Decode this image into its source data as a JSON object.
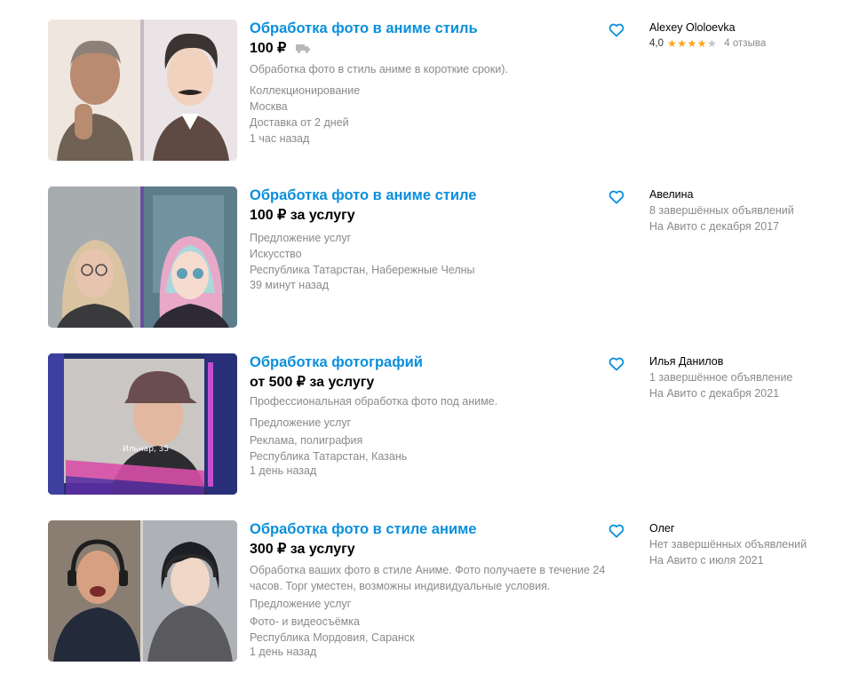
{
  "listings": [
    {
      "title": "Обработка фото в аниме стиль",
      "price": "100 ₽",
      "description": "Обработка фото в стиль аниме в короткие сроки).",
      "category": "Коллекционирование",
      "location": "Москва",
      "delivery": "Доставка от 2 дней",
      "posted": "1 час назад",
      "seller": {
        "name": "Alexey Ololoevka",
        "rating": "4,0",
        "stars": 4,
        "reviews": "4 отзыва"
      }
    },
    {
      "title": "Обработка фото в аниме стиле",
      "price": "100 ₽ за услугу",
      "type": "Предложение услуг",
      "category": "Искусство",
      "location": "Республика Татарстан, Набережные Челны",
      "posted": "39 минут назад",
      "seller": {
        "name": "Авелина",
        "completed": "8 завершённых объявлений",
        "since": "На Авито с декабря 2017"
      }
    },
    {
      "title": "Обработка фотографий",
      "price": "от 500 ₽ за услугу",
      "description": "Профессиональная обработка фото под аниме.",
      "type": "Предложение услуг",
      "category": "Реклама, полиграфия",
      "location": "Республика Татарстан, Казань",
      "posted": "1 день назад",
      "image_caption": "Ильнар, 35",
      "seller": {
        "name": "Илья Данилов",
        "completed": "1 завершённое объявление",
        "since": "На Авито с декабря 2021"
      }
    },
    {
      "title": "Обработка фото в стиле аниме",
      "price": "300 ₽ за услугу",
      "description": "Обработка ваших фото в стиле Аниме. Фото получаете в течение 24 часов. Торг уместен, возможны индивидуальные условия.",
      "type": "Предложение услуг",
      "category": "Фото- и видеосъёмка",
      "location": "Республика Мордовия, Саранск",
      "posted": "1 день назад",
      "seller": {
        "name": "Олег",
        "completed": "Нет завершённых объявлений",
        "since": "На Авито с июля 2021"
      }
    }
  ],
  "colors": {
    "title": "#0a8fdc",
    "secondary_text": "#8a8a8a",
    "star": "#ffa318",
    "favorite": "#0a8fdc"
  },
  "icons": {
    "favorite": "heart-outline-icon",
    "delivery": "truck-icon",
    "rating": "star-icon"
  }
}
